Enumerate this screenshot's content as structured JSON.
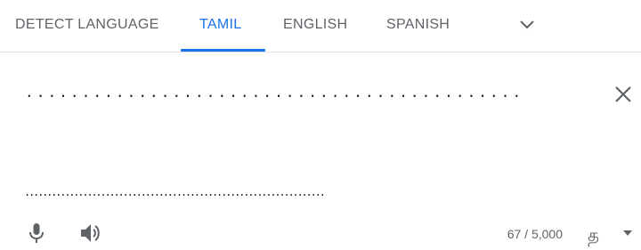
{
  "tabs": [
    {
      "label": "DETECT LANGUAGE",
      "active": false
    },
    {
      "label": "TAMIL",
      "active": true
    },
    {
      "label": "ENGLISH",
      "active": false
    },
    {
      "label": "SPANISH",
      "active": false
    }
  ],
  "more_languages_icon": "chevron-down-icon",
  "source_text": {
    "line_1": "...........................................................................",
    "line_2": "..................................................................................."
  },
  "clear_icon": "close-icon",
  "toolbar": {
    "microphone_icon": "microphone-icon",
    "listen_icon": "speaker-icon",
    "char_count": "67 / 5,000",
    "input_tool_glyph": "த",
    "input_tool_caret_icon": "caret-down-icon"
  },
  "colors": {
    "active_tab": "#1a73e8",
    "inactive_tab": "#5f6368",
    "divider": "#e0e0e0",
    "text": "#202124"
  }
}
